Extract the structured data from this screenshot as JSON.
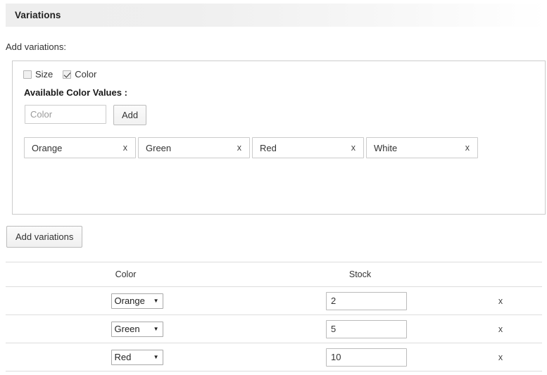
{
  "section": {
    "title": "Variations"
  },
  "add_variations_label": "Add variations:",
  "panel": {
    "attribute_checkboxes": [
      {
        "label": "Size",
        "checked": false
      },
      {
        "label": "Color",
        "checked": true
      }
    ],
    "available_values_title": "Available Color Values :",
    "value_input": {
      "placeholder": "Color",
      "value": ""
    },
    "add_button_label": "Add",
    "value_tags": [
      {
        "label": "Orange",
        "remove": "x"
      },
      {
        "label": "Green",
        "remove": "x"
      },
      {
        "label": "Red",
        "remove": "x"
      },
      {
        "label": "White",
        "remove": "x"
      }
    ]
  },
  "add_variations_button_label": "Add variations",
  "table": {
    "headers": [
      "Color",
      "Stock"
    ],
    "remove_header": "",
    "rows": [
      {
        "color": "Orange",
        "stock": "2",
        "remove": "x"
      },
      {
        "color": "Green",
        "stock": "5",
        "remove": "x"
      },
      {
        "color": "Red",
        "stock": "10",
        "remove": "x"
      }
    ],
    "color_options": [
      "Orange",
      "Green",
      "Red",
      "White"
    ],
    "caret_glyph": "▼"
  },
  "colors": {
    "header_gradient_start": "#eeeeee",
    "header_gradient_end": "#ffffff",
    "border": "#cccccc",
    "table_border": "#dddddd",
    "text": "#333333"
  }
}
